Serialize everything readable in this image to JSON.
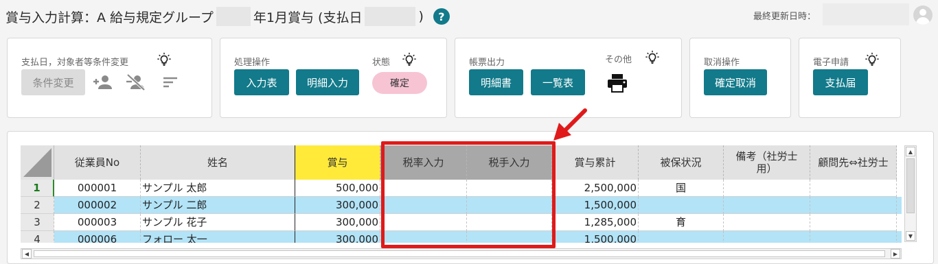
{
  "header": {
    "title_prefix": "賞与入力計算：A 給与規定グループ",
    "title_mid": "年1月賞与 (支払日",
    "title_suffix": ")",
    "updated_label": "最終更新日時："
  },
  "panels": {
    "conditions": {
      "label": "支払日，対象者等条件変更",
      "change_button": "条件変更"
    },
    "processing": {
      "label": "処理操作",
      "input_table_button": "入力表",
      "detail_input_button": "明細入力",
      "status_label": "状態",
      "status_value": "確定"
    },
    "reports": {
      "label": "帳票出力",
      "statement_button": "明細書",
      "list_button": "一覧表",
      "other_label": "その他"
    },
    "cancel": {
      "label": "取消操作",
      "cancel_confirm_button": "確定取消"
    },
    "e_application": {
      "label": "電子申請",
      "payment_report_button": "支払届"
    }
  },
  "table": {
    "columns": [
      "従業員No",
      "姓名",
      "賞与",
      "税率入力",
      "税手入力",
      "賞与累計",
      "被保状況",
      "備考（社労士用）",
      "顧問先⇔社労士"
    ],
    "rows": [
      {
        "n": "1",
        "emp": "000001",
        "name": "サンプル 太郎",
        "bonus": "500,000",
        "rate": "",
        "manual": "",
        "cum": "2,500,000",
        "ins": "国",
        "note1": "",
        "note2": ""
      },
      {
        "n": "2",
        "emp": "000002",
        "name": "サンプル 二郎",
        "bonus": "300,000",
        "rate": "",
        "manual": "",
        "cum": "1,500,000",
        "ins": "",
        "note1": "",
        "note2": ""
      },
      {
        "n": "3",
        "emp": "000003",
        "name": "サンプル 花子",
        "bonus": "300,000",
        "rate": "",
        "manual": "",
        "cum": "1,285,000",
        "ins": "育",
        "note1": "",
        "note2": ""
      },
      {
        "n": "4",
        "emp": "000006",
        "name": "フォロー 太一",
        "bonus": "300,000",
        "rate": "",
        "manual": "",
        "cum": "1,500,000",
        "ins": "",
        "note1": "",
        "note2": ""
      }
    ]
  },
  "colors": {
    "accent": "#127a8a",
    "highlight": "#e01a1a",
    "row_blue": "#b3e3f7",
    "header_yellow": "#ffea3a",
    "status_pink": "#f7c4d4"
  },
  "icons": [
    "help-icon",
    "bulb-icon",
    "person-add-icon",
    "person-remove-icon",
    "sort-icon",
    "printer-icon",
    "avatar-icon"
  ]
}
